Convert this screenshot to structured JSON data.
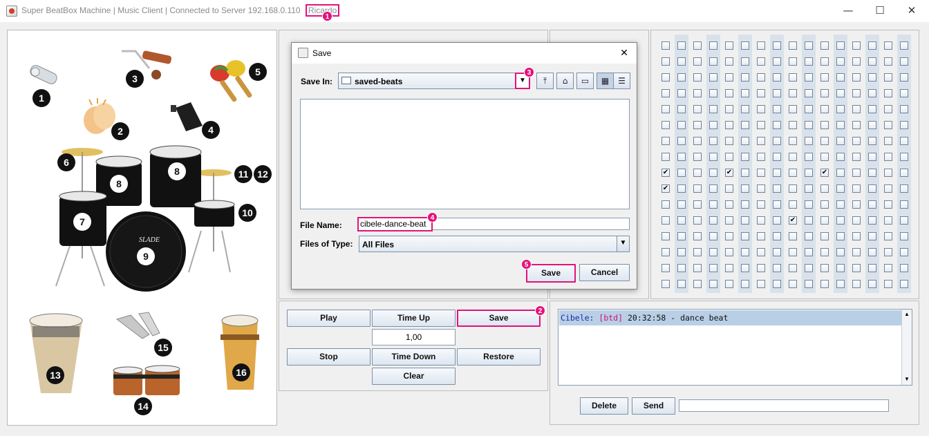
{
  "window": {
    "title": "Super BeatBox Machine | Music Client | Connected to Server 192.168.0.110",
    "user": "Ricardo",
    "minimize": "—",
    "maximize": "☐",
    "close": "✕"
  },
  "callouts": [
    "1",
    "2",
    "3",
    "4",
    "5"
  ],
  "instruments": {
    "labels": [
      "1",
      "2",
      "3",
      "4",
      "5",
      "6",
      "7",
      "8",
      "8",
      "9",
      "10",
      "11",
      "12",
      "13",
      "14",
      "15",
      "16"
    ],
    "drum_brand": "SLADE"
  },
  "controls": {
    "play": "Play",
    "time_up": "Time Up",
    "save": "Save",
    "tempo": "1,00",
    "stop": "Stop",
    "time_down": "Time Down",
    "restore": "Restore",
    "clear": "Clear"
  },
  "beat_grid": {
    "rows": 16,
    "cols": 16,
    "checked": [
      [
        8,
        0
      ],
      [
        8,
        4
      ],
      [
        8,
        10
      ],
      [
        9,
        0
      ],
      [
        11,
        8
      ]
    ]
  },
  "dialog": {
    "title": "Save",
    "close": "✕",
    "save_in_label": "Save In:",
    "save_in_value": "saved-beats",
    "file_name_label": "File Name:",
    "file_name_value": "cibele-dance-beat",
    "files_of_type_label": "Files of Type:",
    "files_of_type_value": "All Files",
    "save_button": "Save",
    "cancel_button": "Cancel"
  },
  "chat": {
    "messages": [
      {
        "sender": "Cibele:",
        "tag": "[btd]",
        "text": "20:32:58 - dance beat"
      }
    ],
    "delete_button": "Delete",
    "send_button": "Send",
    "input_value": ""
  },
  "colors": {
    "highlight": "#e3127a",
    "chat_selected": "#b8cfe6",
    "grid_column": "#d9e2ea",
    "button_border": "#7a8fa8"
  }
}
